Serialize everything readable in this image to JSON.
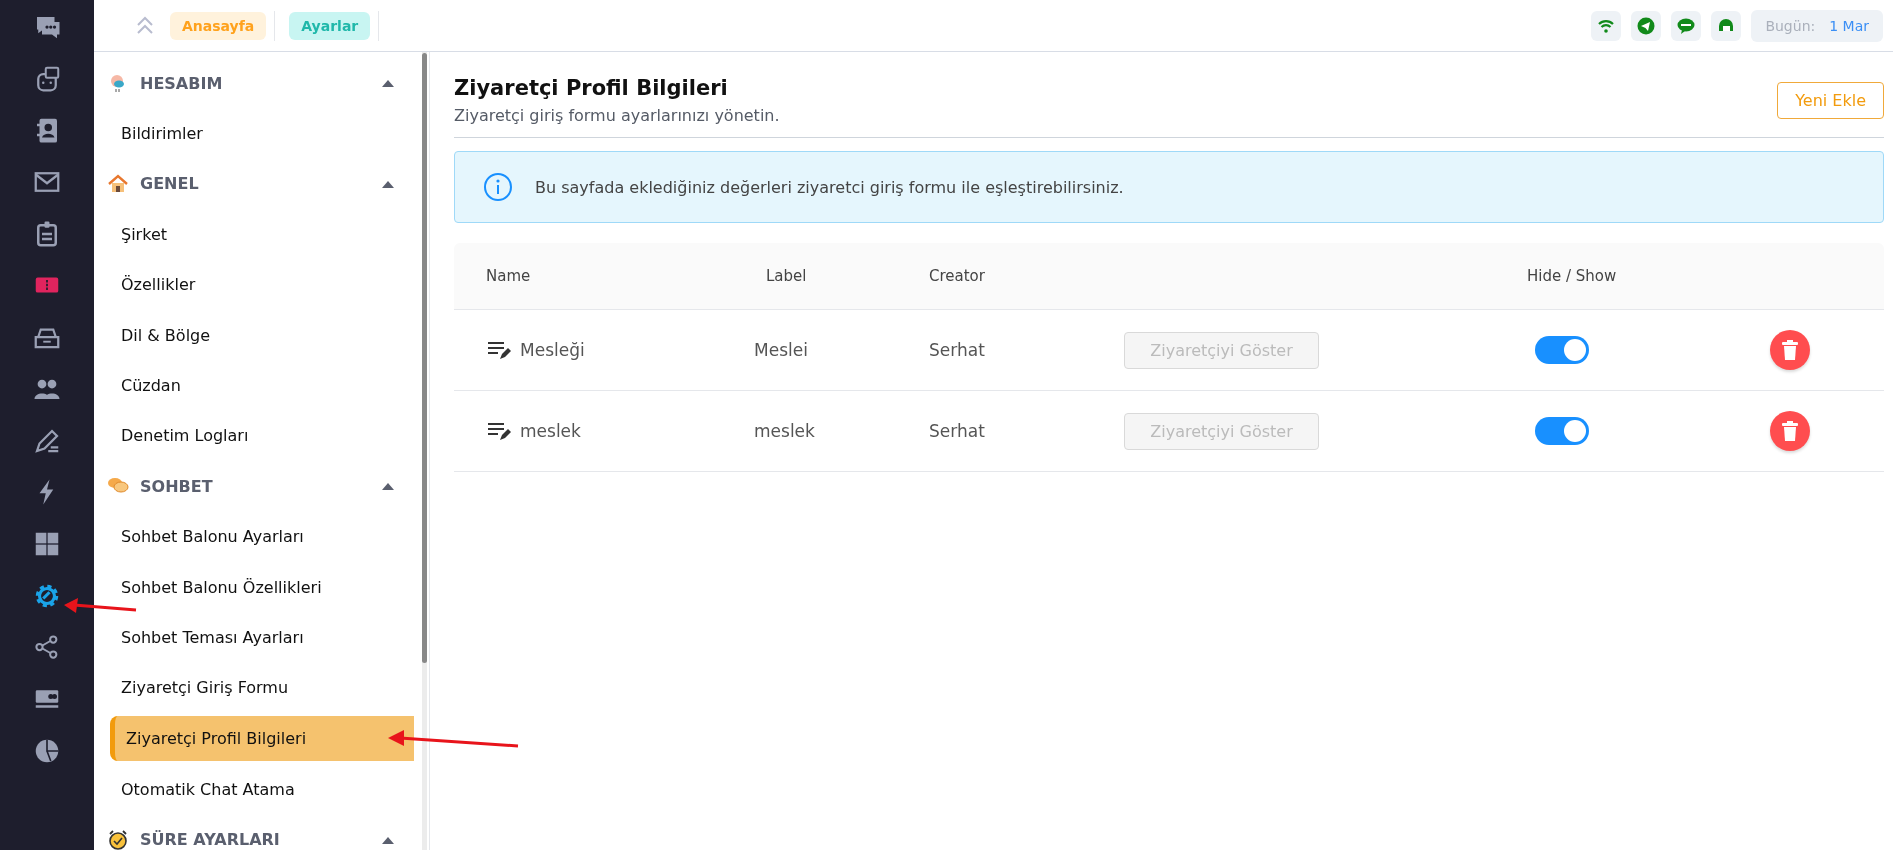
{
  "rail": {
    "items": [
      {
        "selected": false
      },
      {
        "selected": false
      },
      {
        "selected": false
      },
      {
        "selected": false
      },
      {
        "selected": false
      },
      {
        "selected": false
      },
      {
        "selected": false
      },
      {
        "selected": false
      },
      {
        "selected": false
      },
      {
        "selected": false
      },
      {
        "selected": false
      },
      {
        "selected": true
      },
      {
        "selected": false
      },
      {
        "selected": false
      },
      {
        "selected": false
      }
    ]
  },
  "topbar": {
    "breadcrumbs": [
      {
        "label": "Anasayfa",
        "kind": "home"
      },
      {
        "label": "Ayarlar",
        "kind": "current"
      }
    ],
    "date_label": "Bugün:",
    "date_value": "1 Mar"
  },
  "settings_nav": {
    "sections": [
      {
        "title": "HESABIM",
        "kind": "bird",
        "expanded": true,
        "items": [
          {
            "label": "Bildirimler",
            "selected": false
          }
        ]
      },
      {
        "title": "GENEL",
        "kind": "house",
        "expanded": true,
        "items": [
          {
            "label": "Şirket",
            "selected": false
          },
          {
            "label": "Özellikler",
            "selected": false
          },
          {
            "label": "Dil & Bölge",
            "selected": false
          },
          {
            "label": "Cüzdan",
            "selected": false
          },
          {
            "label": "Denetim Logları",
            "selected": false
          }
        ]
      },
      {
        "title": "SOHBET",
        "kind": "chat",
        "expanded": true,
        "items": [
          {
            "label": "Sohbet Balonu Ayarları",
            "selected": false
          },
          {
            "label": "Sohbet Balonu Özellikleri",
            "selected": false
          },
          {
            "label": "Sohbet Teması Ayarları",
            "selected": false
          },
          {
            "label": "Ziyaretçi Giriş Formu",
            "selected": false
          },
          {
            "label": "Ziyaretçi Profil Bilgileri",
            "selected": true
          },
          {
            "label": "Otomatik Chat Atama",
            "selected": false
          }
        ]
      },
      {
        "title": "SÜRE AYARLARI",
        "kind": "clock",
        "expanded": true
      }
    ]
  },
  "page": {
    "title": "Ziyaretçi Profil Bilgileri",
    "subtitle": "Ziyaretçi giriş formu ayarlarınızı yönetin.",
    "add_button": "Yeni Ekle",
    "info": "Bu sayfada eklediğiniz değerleri ziyaretci giriş formu ile eşleştirebilirsiniz."
  },
  "table": {
    "columns": [
      "Name",
      "Label",
      "Creator",
      "Hide / Show"
    ],
    "rows": [
      {
        "name": "Mesleği",
        "label": "Meslei",
        "creator": "Serhat",
        "action": "Ziyaretçiyi Göster",
        "disabled": true,
        "visible": true
      },
      {
        "name": "meslek",
        "label": "meslek",
        "creator": "Serhat",
        "action": "Ziyaretçiyi Göster",
        "disabled": true,
        "visible": true
      }
    ]
  }
}
